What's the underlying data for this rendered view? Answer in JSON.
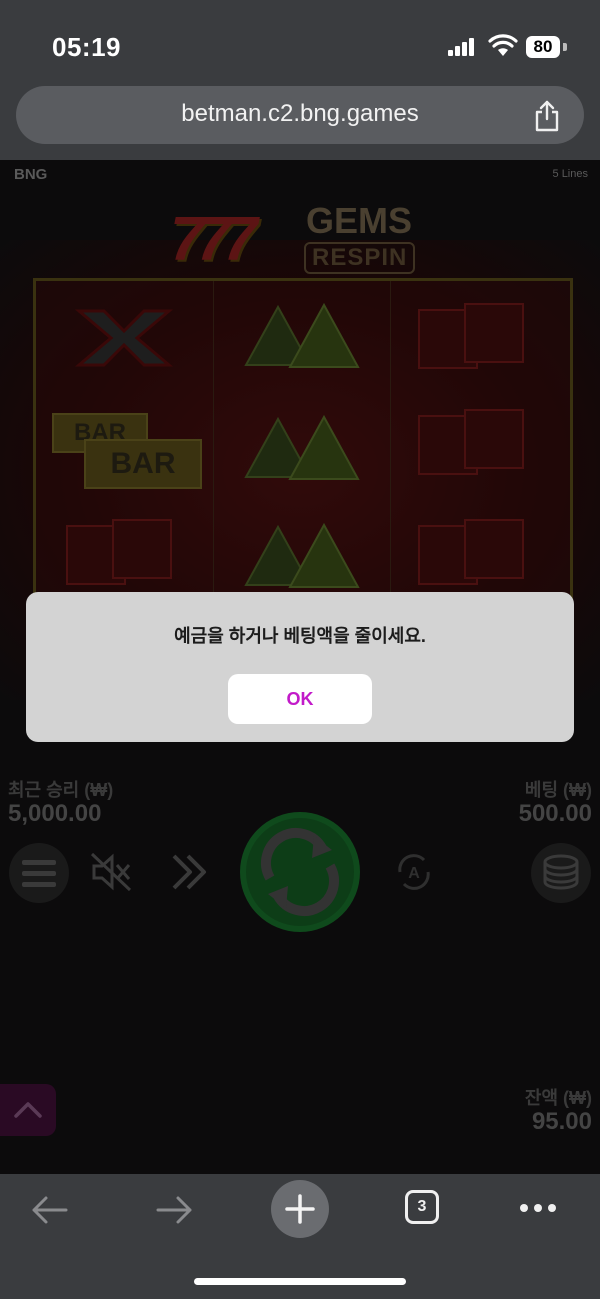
{
  "status_bar": {
    "time": "05:19",
    "battery": "80"
  },
  "browser": {
    "url": "betman.c2.bng.games",
    "tab_count": "3"
  },
  "game": {
    "provider": "BNG",
    "lines_label": "5 Lines",
    "logo": {
      "sevens": "777",
      "gems": "GEMS",
      "respin": "RESPIN"
    },
    "symbols": {
      "bar": "BAR"
    },
    "last_win_label": "최근 승리 (₩)",
    "last_win_value": "5,000.00",
    "bet_label": "베팅 (₩)",
    "bet_value": "500.00",
    "balance_label": "잔액 (₩)",
    "balance_value": "95.00",
    "autoplay_letter": "A"
  },
  "dialog": {
    "message": "예금을 하거나 베팅액을 줄이세요.",
    "ok_label": "OK"
  },
  "icons": [
    "signal-icon",
    "wifi-icon",
    "share-icon",
    "menu-icon",
    "sound-muted-icon",
    "fast-forward-icon",
    "spin-icon",
    "autoplay-icon",
    "coins-icon",
    "chevron-up-icon",
    "back-icon",
    "forward-icon",
    "new-tab-icon",
    "tabs-icon",
    "more-icon"
  ]
}
